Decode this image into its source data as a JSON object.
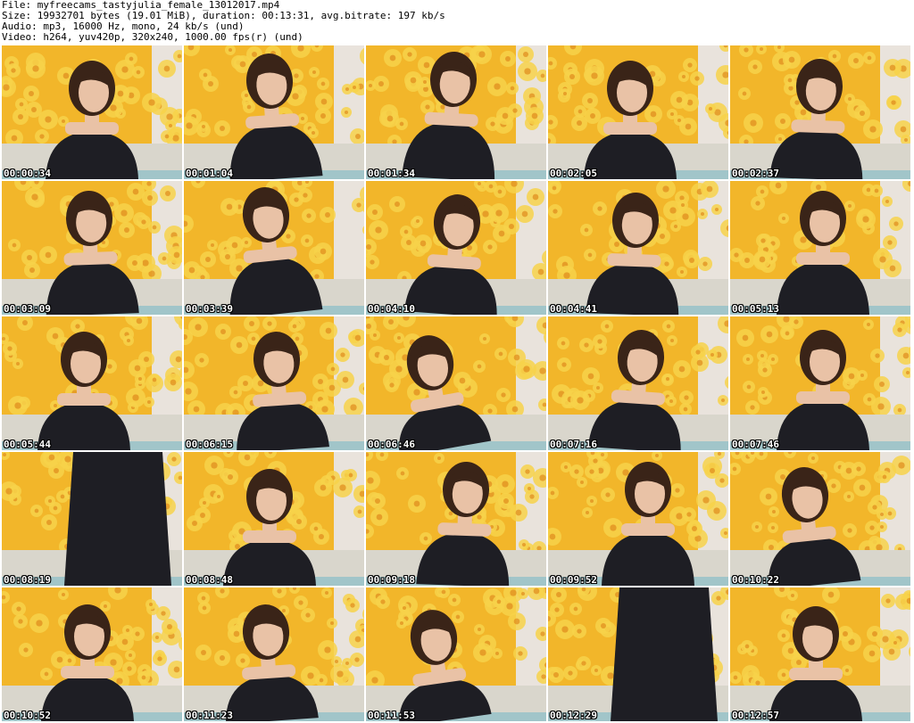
{
  "header": {
    "file_line": "File: myfreecams_tastyjulia_female_13012017.mp4",
    "size_line": "Size: 19932701 bytes (19.01 MiB), duration: 00:13:31, avg.bitrate: 197 kb/s",
    "audio_line": "Audio: mp3, 16000 Hz, mono, 24 kb/s (und)",
    "video_line": "Video: h264, yuv420p, 320x240, 1000.00 fps(r) (und)"
  },
  "thumbnails": [
    {
      "timestamp": "00:00:34"
    },
    {
      "timestamp": "00:01:04"
    },
    {
      "timestamp": "00:01:34"
    },
    {
      "timestamp": "00:02:05"
    },
    {
      "timestamp": "00:02:37"
    },
    {
      "timestamp": "00:03:09"
    },
    {
      "timestamp": "00:03:39"
    },
    {
      "timestamp": "00:04:10"
    },
    {
      "timestamp": "00:04:41"
    },
    {
      "timestamp": "00:05:13"
    },
    {
      "timestamp": "00:05:44"
    },
    {
      "timestamp": "00:06:15"
    },
    {
      "timestamp": "00:06:46"
    },
    {
      "timestamp": "00:07:16"
    },
    {
      "timestamp": "00:07:46"
    },
    {
      "timestamp": "00:08:19"
    },
    {
      "timestamp": "00:08:48"
    },
    {
      "timestamp": "00:09:18"
    },
    {
      "timestamp": "00:09:52"
    },
    {
      "timestamp": "00:10:22"
    },
    {
      "timestamp": "00:10:52"
    },
    {
      "timestamp": "00:11:23"
    },
    {
      "timestamp": "00:11:53"
    },
    {
      "timestamp": "00:12:29"
    },
    {
      "timestamp": "00:12:57"
    }
  ],
  "colors": {
    "wallpaper": "#f2b62a",
    "flower": "#f7d24a",
    "flower_center": "#e08a1c",
    "sofa": "#d9d6cc",
    "wall": "#e9e3dc",
    "hair": "#3a2418",
    "skin": "#e9c2a6",
    "dress": "#1e1e24",
    "blanket": "#3aa6c4"
  }
}
